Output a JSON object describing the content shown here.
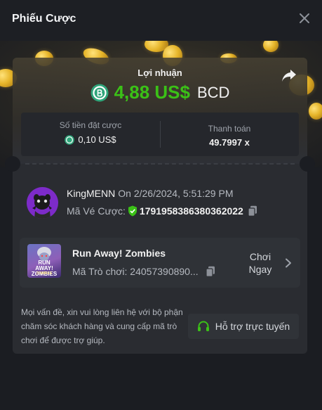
{
  "header": {
    "title": "Phiếu Cược",
    "close_icon": "close-icon"
  },
  "profit": {
    "label": "Lợi nhuận",
    "amount": "4,88 US$",
    "currency": "BCD",
    "icon": "bcd-coin-icon",
    "share_icon": "share-icon"
  },
  "stats": {
    "bet_amount_label": "Số tiền đặt cược",
    "bet_amount_value": "0,10 US$",
    "payout_label": "Thanh toán",
    "payout_value": "49.7997 x"
  },
  "user": {
    "name": "KingMENN",
    "date_text": "On 2/26/2024, 5:51:29 PM",
    "ticket_label": "Mã Vé Cược:",
    "ticket_id": "1791958386380362022"
  },
  "game": {
    "thumb_title": "RUN AWAY! ZOMBIES",
    "thumb_subtitle": "ZOMBIES",
    "name": "Run Away! Zombies",
    "id_text": "Mã Trò chơi: 24057390890...",
    "play_label": "Chơi Ngay"
  },
  "support": {
    "text": "Mọi vấn đề, xin vui lòng liên hệ với bộ phận chăm sóc khách hàng và cung cấp mã trò chơi để được trợ giúp.",
    "button_label": "Hỗ trợ trực tuyến"
  },
  "colors": {
    "accent_green": "#3bc117",
    "background": "#1b1d22",
    "card": "#2a2c31",
    "avatar_bg": "#7d2bc9"
  }
}
